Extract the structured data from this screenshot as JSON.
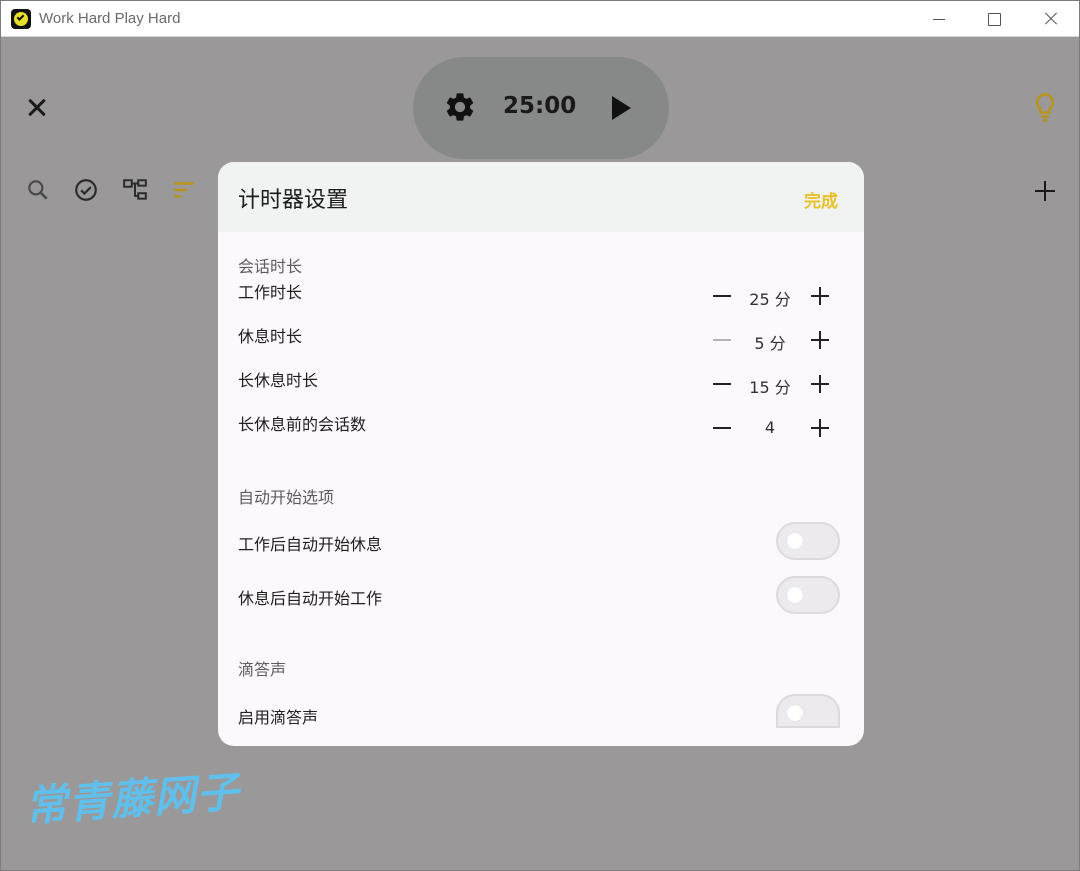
{
  "window": {
    "title": "Work Hard Play Hard"
  },
  "timer": {
    "time": "25:00"
  },
  "dialog": {
    "title": "计时器设置",
    "done_label": "完成",
    "sections": {
      "session": {
        "title": "会话时长",
        "rows": [
          {
            "label": "工作时长",
            "value": "25 分",
            "minus_enabled": true
          },
          {
            "label": "休息时长",
            "value": "5 分",
            "minus_enabled": false
          },
          {
            "label": "长休息时长",
            "value": "15 分",
            "minus_enabled": true
          },
          {
            "label": "长休息前的会话数",
            "value": "4",
            "minus_enabled": true
          }
        ]
      },
      "autostart": {
        "title": "自动开始选项",
        "rows": [
          {
            "label": "工作后自动开始休息",
            "on": false
          },
          {
            "label": "休息后自动开始工作",
            "on": false
          }
        ]
      },
      "tick": {
        "title": "滴答声",
        "rows": [
          {
            "label": "启用滴答声",
            "on": false
          }
        ]
      }
    }
  },
  "colors": {
    "accent": "#e8c12a",
    "overlay": "#9a9899",
    "dialog_bg": "#fdf8fc"
  },
  "watermark": "常青藤网子"
}
